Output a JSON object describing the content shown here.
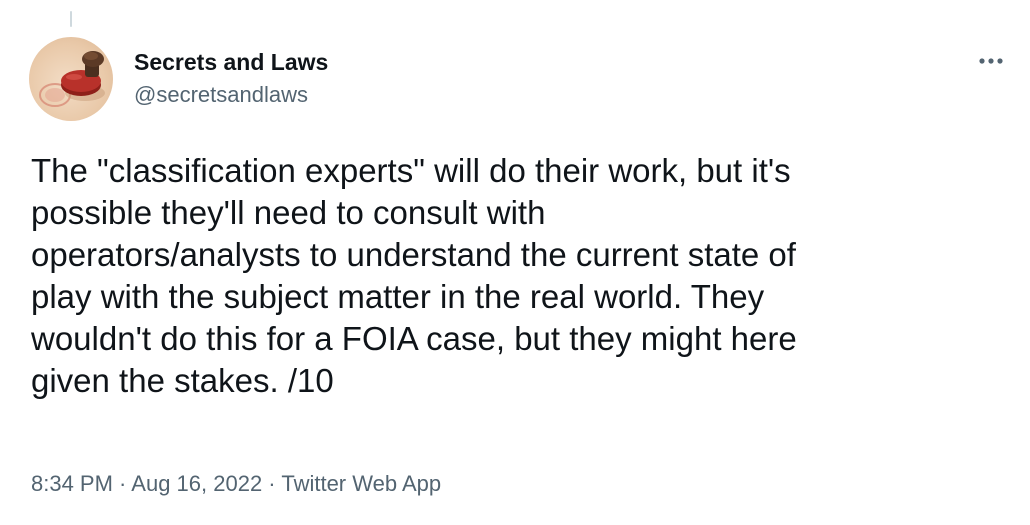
{
  "author": {
    "display_name": "Secrets and Laws",
    "handle": "@secretsandlaws",
    "avatar_icon": "rubber-stamp-icon"
  },
  "more_icon": "more-horizontal-icon",
  "tweet": {
    "text": "The \"classification experts\" will do their work, but it's\npossible they'll need to consult with\noperators/analysts to understand the current state of\nplay with the subject matter in the real world. They\nwouldn't do this for a FOIA case, but they might here\ngiven the stakes. /10"
  },
  "meta": {
    "time": "8:34 PM",
    "separator1": " · ",
    "date": "Aug 16, 2022",
    "separator2": " · ",
    "source": "Twitter Web App"
  },
  "colors": {
    "text_primary": "#0f1419",
    "text_secondary": "#536471",
    "background": "#ffffff",
    "stamp_red": "#b8312a"
  }
}
